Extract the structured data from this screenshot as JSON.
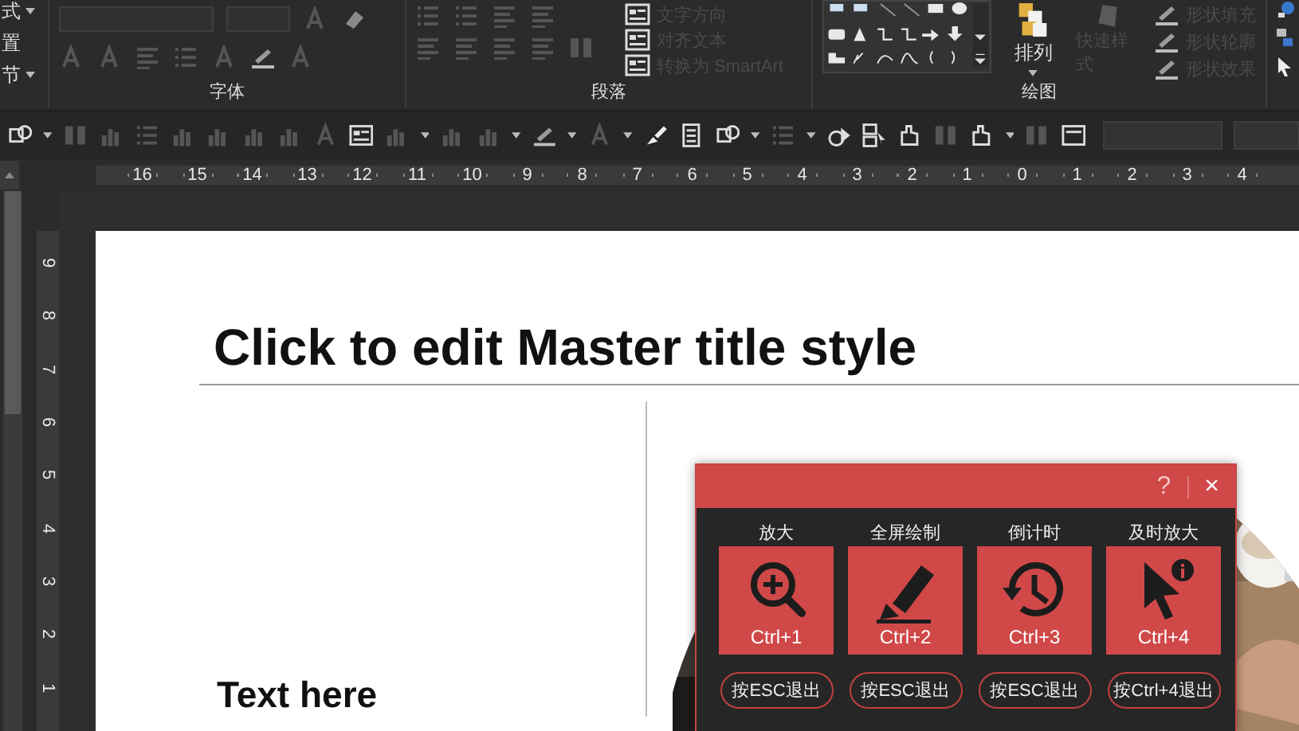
{
  "ribbon": {
    "left_commands": [
      {
        "label": "式",
        "dropdown": true
      },
      {
        "label": "置",
        "dropdown": false
      },
      {
        "label": "节",
        "dropdown": true
      }
    ],
    "groups": [
      {
        "label": "字体"
      },
      {
        "label": "段落"
      },
      {
        "label": "绘图"
      }
    ],
    "paragraph_commands": [
      {
        "label": "文字方向",
        "disabled": true
      },
      {
        "label": "对齐文本",
        "disabled": true
      },
      {
        "label": "转换为 SmartArt",
        "disabled": true
      }
    ],
    "arrange": {
      "label": "排列"
    },
    "quick_styles": {
      "label": "快速样式",
      "disabled": true
    },
    "shape_commands": [
      {
        "label": "形状填充",
        "disabled": true
      },
      {
        "label": "形状轮廓",
        "disabled": true
      },
      {
        "label": "形状效果",
        "disabled": true
      }
    ]
  },
  "ruler": {
    "horizontal": [
      "16",
      "15",
      "14",
      "13",
      "12",
      "11",
      "10",
      "9",
      "8",
      "7",
      "6",
      "5",
      "4",
      "3",
      "2",
      "1",
      "0",
      "1",
      "2",
      "3",
      "4"
    ],
    "vertical": [
      "9",
      "8",
      "7",
      "6",
      "5",
      "4",
      "3",
      "2",
      "1"
    ]
  },
  "slide": {
    "title": "Click to edit Master title style",
    "body_text": "Text here"
  },
  "dialog": {
    "help": "?",
    "close": "×",
    "tools": [
      {
        "label": "放大",
        "shortcut": "Ctrl+1",
        "exit": "按ESC退出",
        "kind": "magnifier"
      },
      {
        "label": "全屏绘制",
        "shortcut": "Ctrl+2",
        "exit": "按ESC退出",
        "kind": "marker"
      },
      {
        "label": "倒计时",
        "shortcut": "Ctrl+3",
        "exit": "按ESC退出",
        "kind": "clock"
      },
      {
        "label": "及时放大",
        "shortcut": "Ctrl+4",
        "exit": "按Ctrl+4退出",
        "kind": "cursor"
      }
    ]
  }
}
